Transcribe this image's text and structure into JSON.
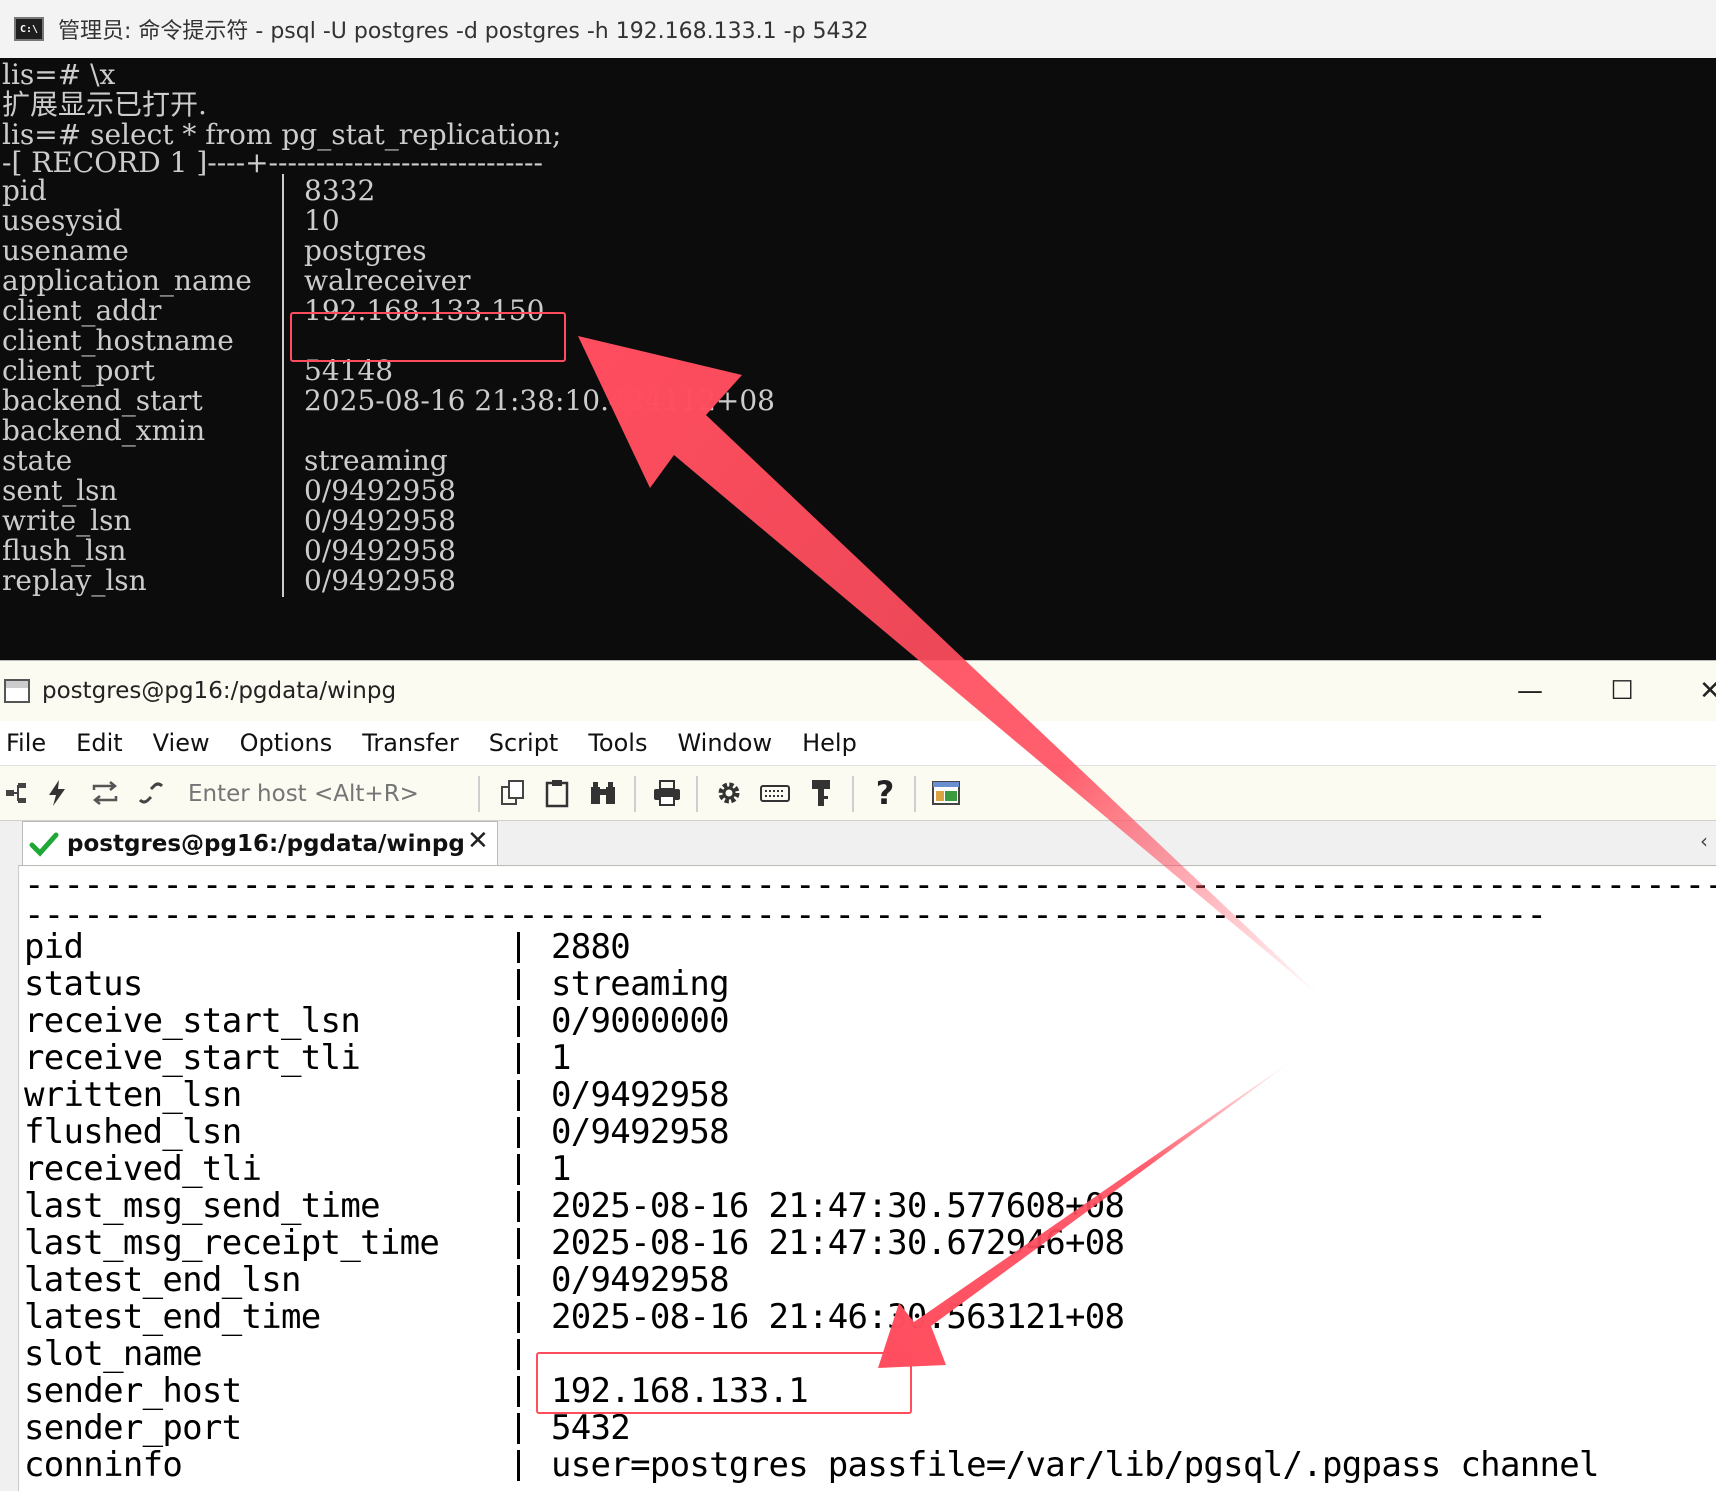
{
  "cmd": {
    "title": "管理员: 命令提示符 - psql  -U postgres -d postgres -h 192.168.133.1 -p 5432",
    "lines": [
      "lis=# \\x",
      "扩展显示已打开.",
      "lis=# select * from pg_stat_replication;",
      "-[ RECORD 1 ]----+-----------------------------"
    ],
    "rows": [
      {
        "key": "pid",
        "value": "8332"
      },
      {
        "key": "usesysid",
        "value": "10"
      },
      {
        "key": "usename",
        "value": "postgres"
      },
      {
        "key": "application_name",
        "value": "walreceiver"
      },
      {
        "key": "client_addr",
        "value": "192.168.133.150"
      },
      {
        "key": "client_hostname",
        "value": ""
      },
      {
        "key": "client_port",
        "value": "54148"
      },
      {
        "key": "backend_start",
        "value": "2025-08-16 21:38:10.424112+08"
      },
      {
        "key": "backend_xmin",
        "value": ""
      },
      {
        "key": "state",
        "value": "streaming"
      },
      {
        "key": "sent_lsn",
        "value": "0/9492958"
      },
      {
        "key": "write_lsn",
        "value": "0/9492958"
      },
      {
        "key": "flush_lsn",
        "value": "0/9492958"
      },
      {
        "key": "replay_lsn",
        "value": "0/9492958"
      }
    ]
  },
  "crt": {
    "title": "postgres@pg16:/pgdata/winpg",
    "controls": {
      "minimize": "—",
      "maximize": "☐",
      "close": "✕"
    },
    "menu": [
      "File",
      "Edit",
      "View",
      "Options",
      "Transfer",
      "Script",
      "Tools",
      "Window",
      "Help"
    ],
    "host_placeholder": "Enter host <Alt+R>",
    "tab": {
      "label": "postgres@pg16:/pgdata/winpg",
      "close": "✕"
    },
    "dash_lines": [
      "-----------------------------------------------------------------------------------------------",
      "-----------------------------------------------------------------------------"
    ],
    "rows": [
      {
        "key": "pid",
        "value": "2880"
      },
      {
        "key": "status",
        "value": "streaming"
      },
      {
        "key": "receive_start_lsn",
        "value": "0/9000000"
      },
      {
        "key": "receive_start_tli",
        "value": "1"
      },
      {
        "key": "written_lsn",
        "value": "0/9492958"
      },
      {
        "key": "flushed_lsn",
        "value": "0/9492958"
      },
      {
        "key": "received_tli",
        "value": "1"
      },
      {
        "key": "last_msg_send_time",
        "value": "2025-08-16 21:47:30.577608+08"
      },
      {
        "key": "last_msg_receipt_time",
        "value": "2025-08-16 21:47:30.672946+08"
      },
      {
        "key": "latest_end_lsn",
        "value": "0/9492958"
      },
      {
        "key": "latest_end_time",
        "value": "2025-08-16 21:46:30.563121+08"
      },
      {
        "key": "slot_name",
        "value": ""
      },
      {
        "key": "sender_host",
        "value": "192.168.133.1"
      },
      {
        "key": "sender_port",
        "value": "5432"
      },
      {
        "key": "conninfo",
        "value": "user=postgres passfile=/var/lib/pgsql/.pgpass channel"
      }
    ]
  },
  "colors": {
    "cmd_bg": "#0c0c0c",
    "cmd_fg": "#cccccc",
    "annotation": "#ff4d5e"
  }
}
